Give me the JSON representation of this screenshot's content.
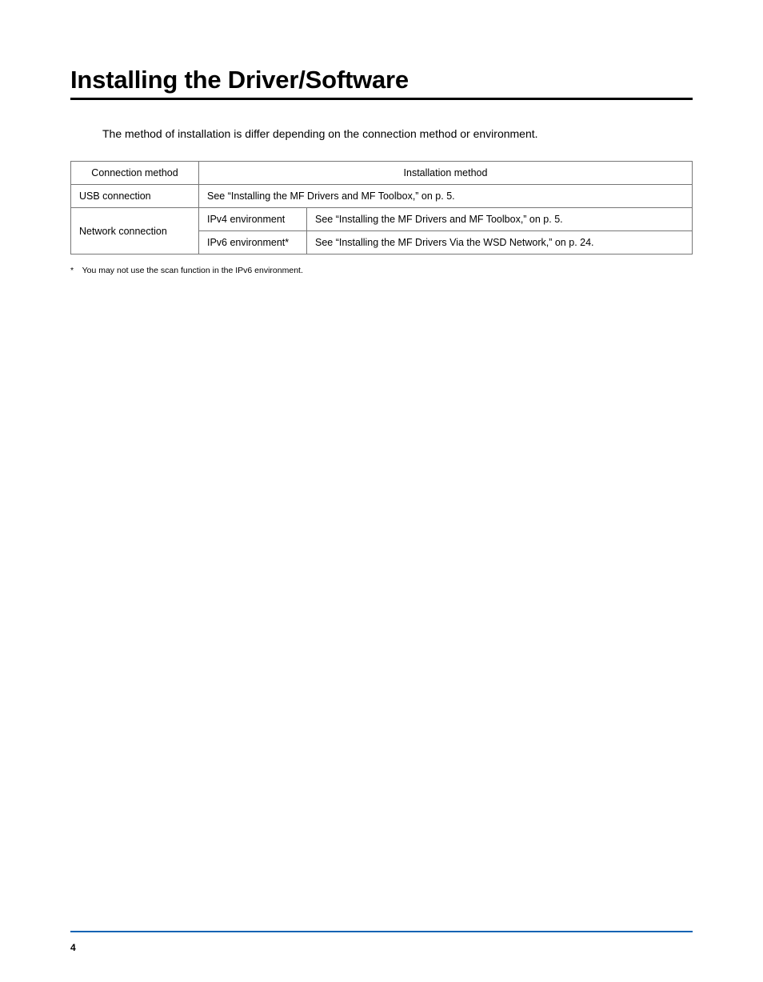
{
  "heading": "Installing the Driver/Software",
  "intro": "The method of installation is differ depending on the connection method or environment.",
  "table": {
    "headers": {
      "connection_method": "Connection method",
      "installation_method": "Installation method"
    },
    "rows": {
      "usb": {
        "label": "USB connection",
        "value": "See “Installing the MF Drivers and MF Toolbox,” on p. 5."
      },
      "network": {
        "label": "Network connection",
        "ipv4": {
          "env": "IPv4 environment",
          "value": "See “Installing the MF Drivers and MF Toolbox,” on p. 5."
        },
        "ipv6": {
          "env": "IPv6 environment*",
          "value": "See “Installing the MF Drivers Via the WSD Network,” on p. 24."
        }
      }
    }
  },
  "footnote": "* You may not use the scan function in the IPv6 environment.",
  "page_number": "4"
}
